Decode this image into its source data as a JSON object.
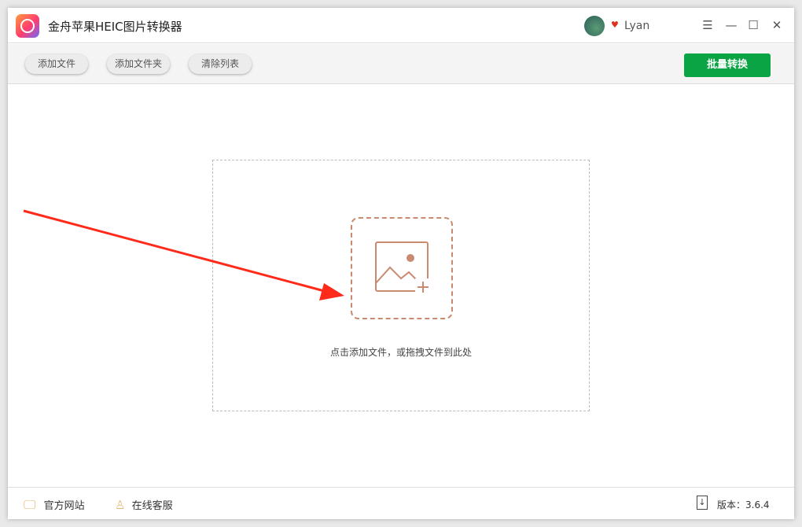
{
  "app": {
    "title": "金舟苹果HEIC图片转换器"
  },
  "user": {
    "name": "Lyan"
  },
  "toolbar": {
    "add_file": "添加文件",
    "add_folder": "添加文件夹",
    "clear_list": "清除列表",
    "convert": "批量转换"
  },
  "dropzone": {
    "hint": "点击添加文件，或拖拽文件到此处"
  },
  "footer": {
    "website": "官方网站",
    "support": "在线客服",
    "version": "版本：3.6.4"
  },
  "colors": {
    "accent": "#0aa444",
    "dropzone_icon": "#c98a70",
    "arrow": "#ff2a1a"
  }
}
